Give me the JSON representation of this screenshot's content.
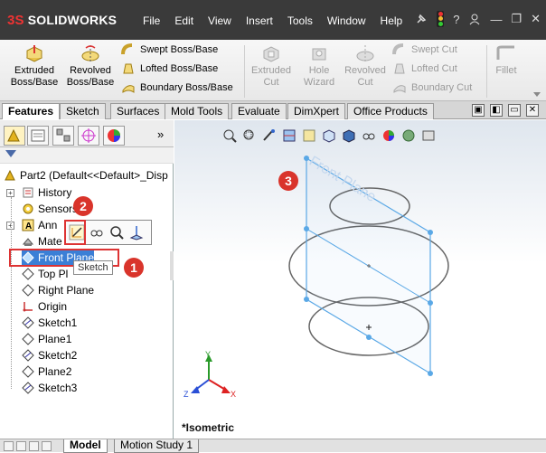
{
  "app": {
    "logo_text": "SOLIDWORKS",
    "logo_glyph": "3S"
  },
  "menu": [
    "File",
    "Edit",
    "View",
    "Insert",
    "Tools",
    "Window",
    "Help"
  ],
  "title_icons": [
    "pushpin-icon",
    "traffic-light-icon",
    "help-icon",
    "user-icon",
    "minimize-icon",
    "restore-icon",
    "close-icon"
  ],
  "title_glyphs": {
    "help": "?",
    "minimize": "—",
    "restore": "❐",
    "close": "✕"
  },
  "ribbon": {
    "extruded_boss": [
      "Extruded",
      "Boss/Base"
    ],
    "revolved_boss": [
      "Revolved",
      "Boss/Base"
    ],
    "swept_boss": "Swept Boss/Base",
    "lofted_boss": "Lofted Boss/Base",
    "boundary_boss": "Boundary Boss/Base",
    "extruded_cut": [
      "Extruded",
      "Cut"
    ],
    "hole_wizard": [
      "Hole",
      "Wizard"
    ],
    "revolved_cut": [
      "Revolved",
      "Cut"
    ],
    "swept_cut": "Swept Cut",
    "lofted_cut": "Lofted Cut",
    "boundary_cut": "Boundary Cut",
    "fillet": "Fillet"
  },
  "tabs": [
    "Features",
    "Sketch",
    "Surfaces",
    "Mold Tools",
    "Evaluate",
    "DimXpert",
    "Office Products"
  ],
  "tab_ctrls": [
    "▣",
    "◧",
    "▭",
    "✕"
  ],
  "tree": {
    "root": "Part2  (Default<<Default>_Disp",
    "items": [
      {
        "label": "History",
        "expandable": true
      },
      {
        "label": "Sensors",
        "expandable": false
      },
      {
        "label": "Ann",
        "expandable": true
      },
      {
        "label": "Mate",
        "expandable": false
      },
      {
        "label": "Front Plane",
        "expandable": false
      },
      {
        "label": "Top Pl",
        "expandable": false
      },
      {
        "label": "Right Plane",
        "expandable": false
      },
      {
        "label": "Origin",
        "expandable": false
      },
      {
        "label": "Sketch1",
        "expandable": false
      },
      {
        "label": "Plane1",
        "expandable": false
      },
      {
        "label": "Sketch2",
        "expandable": false
      },
      {
        "label": "Plane2",
        "expandable": false
      },
      {
        "label": "Sketch3",
        "expandable": false
      }
    ],
    "tooltip": "Sketch",
    "expander_glyph": "+"
  },
  "badges": [
    "1",
    "2",
    "3"
  ],
  "graphics": {
    "plane_label": "Front Plane",
    "view_label": "*Isometric",
    "axis_labels": {
      "x": "X",
      "y": "Y",
      "z": "Z"
    }
  },
  "bottom_tabs": [
    "Model",
    "Motion Study 1"
  ],
  "colors": {
    "accent": "#d9342b",
    "plane": "#5aa8e6",
    "titlebar": "#3a3a3a"
  }
}
